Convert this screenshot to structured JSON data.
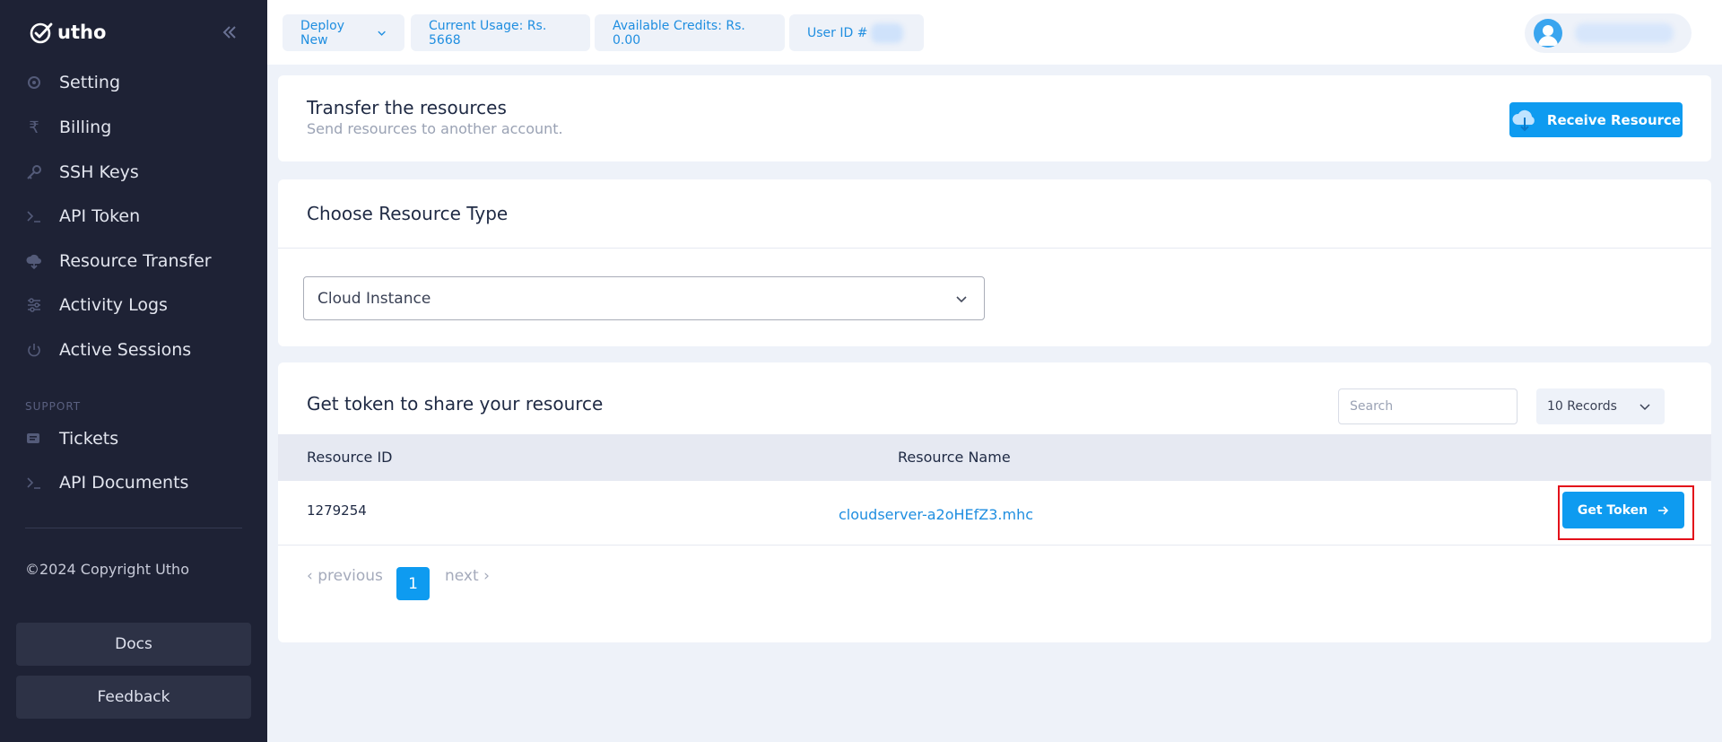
{
  "brand": {
    "name": "utho"
  },
  "sidebar": {
    "items": [
      {
        "label": "Setting",
        "icon": "gear-icon"
      },
      {
        "label": "Billing",
        "icon": "rupee-icon"
      },
      {
        "label": "SSH Keys",
        "icon": "key-icon"
      },
      {
        "label": "API Token",
        "icon": "terminal-icon"
      },
      {
        "label": "Resource Transfer",
        "icon": "cloud-transfer-icon"
      },
      {
        "label": "Activity Logs",
        "icon": "sliders-icon"
      },
      {
        "label": "Active Sessions",
        "icon": "power-icon"
      }
    ],
    "support_label": "SUPPORT",
    "support_items": [
      {
        "label": "Tickets",
        "icon": "ticket-icon"
      },
      {
        "label": "API Documents",
        "icon": "terminal-icon"
      }
    ],
    "copyright": "©2024 Copyright Utho",
    "docs_label": "Docs",
    "feedback_label": "Feedback"
  },
  "topbar": {
    "deploy_label": "Deploy New",
    "current_usage": "Current Usage: Rs. 5668",
    "available_credits": "Available Credits: Rs. 0.00",
    "user_id_label": "User ID #"
  },
  "transfer_card": {
    "title": "Transfer the resources",
    "subtitle": "Send resources to another account.",
    "receive_button": "Receive Resource"
  },
  "type_card": {
    "title": "Choose Resource Type",
    "selected_type": "Cloud Instance"
  },
  "token_card": {
    "title": "Get token to share your resource",
    "search_placeholder": "Search",
    "records_label": "10 Records",
    "columns": [
      "Resource ID",
      "Resource Name"
    ],
    "rows": [
      {
        "id": "1279254",
        "name": "cloudserver-a2oHEfZ3.mhc",
        "action": "Get Token"
      }
    ],
    "pagination": {
      "previous": "‹ previous",
      "current": "1",
      "next": "next ›"
    }
  },
  "colors": {
    "accent": "#0e9bf0",
    "sidebar_bg": "#1e2235",
    "highlight": "#e3101a"
  }
}
